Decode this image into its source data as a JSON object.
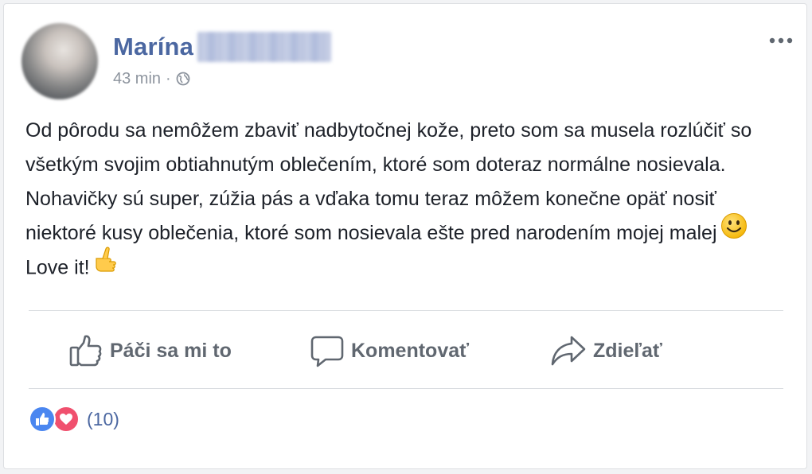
{
  "post": {
    "author_first_name": "Marína",
    "timestamp": "43 min",
    "separator": "·",
    "privacy_icon": "globe-icon",
    "more_icon": "more-options-icon",
    "text_part1": "Od pôrodu sa nemôžem zbaviť nadbytočnej kože, preto som sa musela rozlúčiť so všetkým svojim obtiahnutým oblečením, ktoré som doteraz normálne nosievala. Nohavičky sú super, zúžia pás a vďaka tomu teraz môžem konečne opäť nosiť niektoré kusy oblečenia, ktoré som nosievala ešte pred narodením mojej malej",
    "text_part2": "Love it!",
    "emoji_1": "smile-emoji",
    "emoji_2": "thumbs-point-emoji"
  },
  "actions": {
    "like_label": "Páči sa mi to",
    "comment_label": "Komentovať",
    "share_label": "Zdieľať"
  },
  "reactions": {
    "count": "(10)",
    "types": [
      "like",
      "love"
    ]
  },
  "colors": {
    "author": "#4b67a1",
    "text": "#1d2129",
    "muted": "#8d949e",
    "action": "#606770",
    "like": "#4a86f0",
    "love": "#f0506e"
  }
}
